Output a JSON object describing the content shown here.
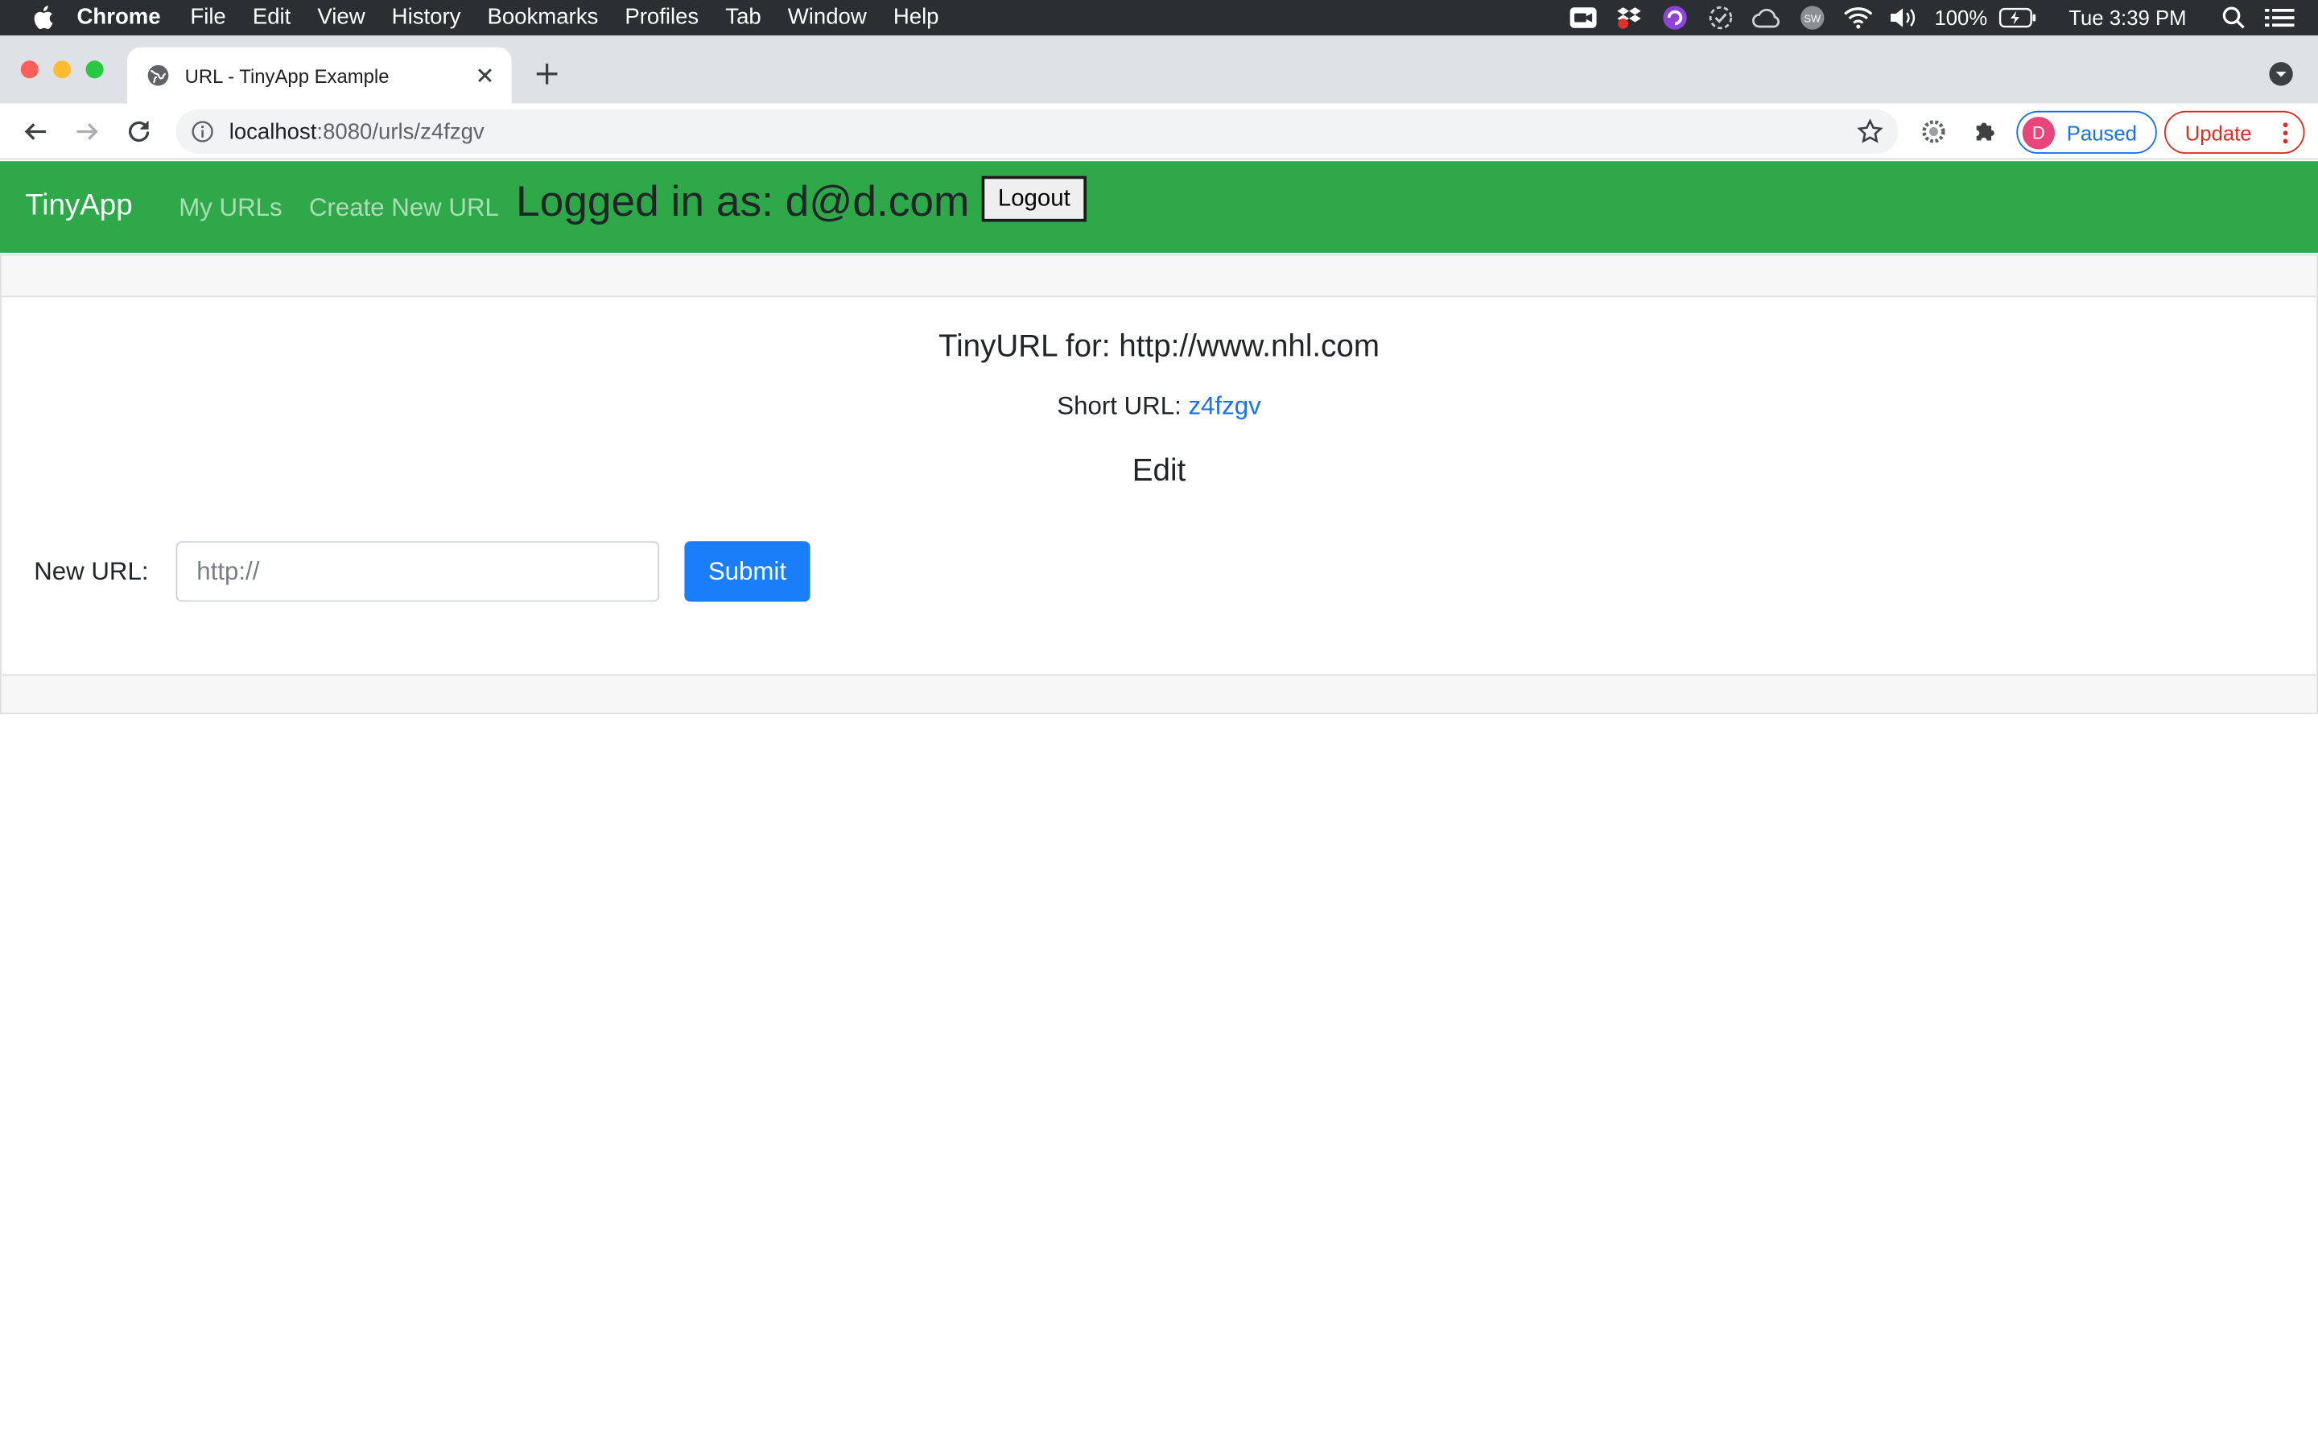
{
  "menubar": {
    "app_name": "Chrome",
    "items": [
      "File",
      "Edit",
      "View",
      "History",
      "Bookmarks",
      "Profiles",
      "Tab",
      "Window",
      "Help"
    ],
    "battery": "100%",
    "clock": "Tue 3:39 PM"
  },
  "browser": {
    "tab_title": "URL - TinyApp Example",
    "url_host": "localhost",
    "url_path": ":8080/urls/z4fzgv",
    "profile_initial": "D",
    "profile_status": "Paused",
    "update_label": "Update"
  },
  "navbar": {
    "brand": "TinyApp",
    "links": [
      "My URLs",
      "Create New URL"
    ],
    "logged_in_text": "Logged in as: d@d.com",
    "logout_label": "Logout"
  },
  "card": {
    "title": "TinyURL for: http://www.nhl.com",
    "short_url_label": "Short URL:",
    "short_url_value": "z4fzgv",
    "edit_heading": "Edit",
    "form": {
      "label": "New URL:",
      "placeholder": "http://",
      "submit_label": "Submit"
    }
  },
  "colors": {
    "navbar_bg": "#2fa84a",
    "submit_bg": "#1a7efb",
    "link": "#1a73e8",
    "profile_accent": "#1a73e8",
    "update_accent": "#d93025"
  }
}
